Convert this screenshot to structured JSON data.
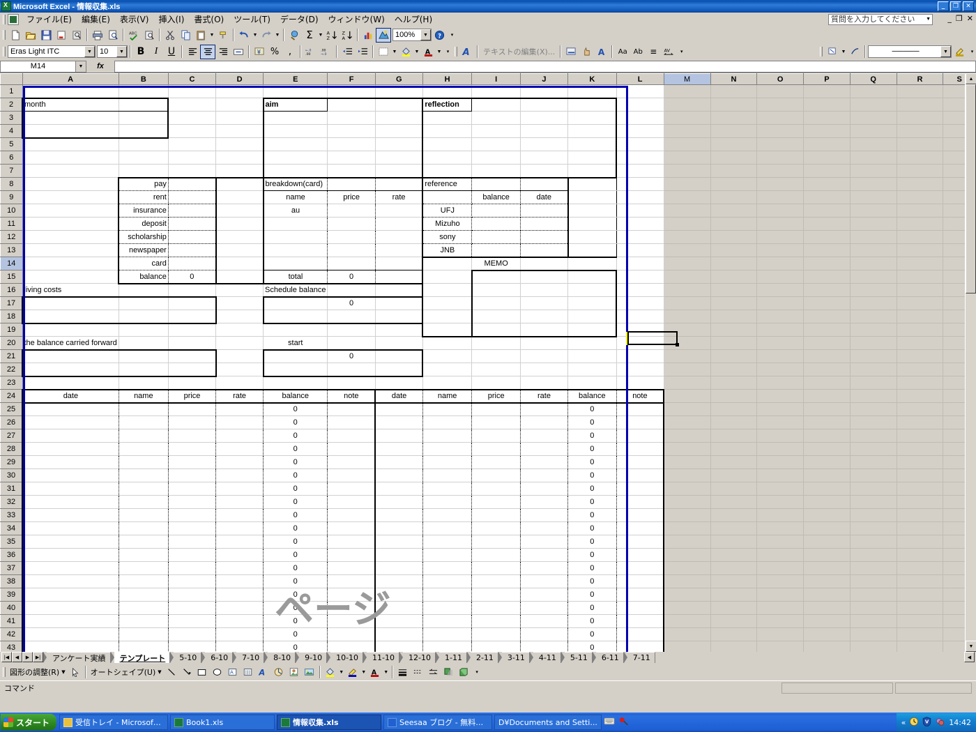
{
  "window": {
    "title": "Microsoft Excel - 情報収集.xls",
    "app_icon": "excel-icon",
    "minimize": "_",
    "maximize": "❐",
    "close": "✕"
  },
  "menubar": {
    "items": [
      {
        "label": "ファイル(E)",
        "name": "menu-file"
      },
      {
        "label": "編集(E)",
        "name": "menu-edit"
      },
      {
        "label": "表示(V)",
        "name": "menu-view"
      },
      {
        "label": "挿入(I)",
        "name": "menu-insert"
      },
      {
        "label": "書式(O)",
        "name": "menu-format"
      },
      {
        "label": "ツール(T)",
        "name": "menu-tools"
      },
      {
        "label": "データ(D)",
        "name": "menu-data"
      },
      {
        "label": "ウィンドウ(W)",
        "name": "menu-window"
      },
      {
        "label": "ヘルプ(H)",
        "name": "menu-help"
      }
    ],
    "ask_box_placeholder": "質問を入力してください",
    "doc_minimize": "_",
    "doc_restore": "❐",
    "doc_close": "✕"
  },
  "standard_toolbar": {
    "zoom_value": "100%",
    "buttons": [
      {
        "name": "new-icon",
        "glyph": "🗋"
      },
      {
        "name": "open-icon",
        "glyph": "🗁"
      },
      {
        "name": "save-icon",
        "glyph": "💾"
      },
      {
        "name": "mail-icon",
        "glyph": "✉"
      },
      {
        "name": "search-icon",
        "glyph": "🔍"
      },
      {
        "name": "print-icon",
        "glyph": "🖨"
      },
      {
        "name": "print-preview-icon",
        "glyph": "🔎"
      },
      {
        "name": "spellcheck-icon",
        "glyph": "ABC"
      },
      {
        "name": "research-icon",
        "glyph": "📑"
      },
      {
        "name": "cut-icon",
        "glyph": "✂"
      },
      {
        "name": "copy-icon",
        "glyph": "⧉"
      },
      {
        "name": "paste-icon",
        "glyph": "📋"
      },
      {
        "name": "format-painter-icon",
        "glyph": "🖌"
      },
      {
        "name": "undo-icon",
        "glyph": "↶"
      },
      {
        "name": "redo-icon",
        "glyph": "↷"
      },
      {
        "name": "hyperlink-icon",
        "glyph": "🌐"
      },
      {
        "name": "autosum-icon",
        "glyph": "Σ"
      },
      {
        "name": "sort-asc-icon",
        "glyph": "A↓"
      },
      {
        "name": "sort-desc-icon",
        "glyph": "Z↓"
      },
      {
        "name": "chart-wizard-icon",
        "glyph": "📊"
      },
      {
        "name": "drawing-icon",
        "glyph": "◮"
      },
      {
        "name": "help-icon",
        "glyph": "?"
      }
    ]
  },
  "formatting_toolbar": {
    "font_name": "Eras Light ITC",
    "font_size": "10",
    "bold": "B",
    "italic": "I",
    "underline": "U",
    "align_left": "≡",
    "align_center": "≡",
    "align_right": "≡",
    "merge_center": "⊞",
    "currency": "¥",
    "percent": "%",
    "comma": ",",
    "inc_decimal": ".00",
    "dec_decimal": ".0",
    "dec_indent": "⇤",
    "inc_indent": "⇥",
    "borders": "⊞",
    "fill_color": "🪣",
    "font_color": "A"
  },
  "wordart_toolbar": {
    "insert_wordart": "A",
    "edit_text_label": "テキストの編集(X)...",
    "gallery": "▤",
    "format": "✋",
    "shape": "A",
    "same_height": "Aa",
    "vertical_text": "Ab",
    "align": "≡",
    "char_spacing": "AV"
  },
  "lines_toolbar": {
    "shadow_style": "▨",
    "line_style": "─────"
  },
  "formula_bar": {
    "name_box_value": "M14",
    "fx_label": "fx",
    "formula_value": ""
  },
  "grid": {
    "columns": [
      "A",
      "B",
      "C",
      "D",
      "E",
      "F",
      "G",
      "H",
      "I",
      "J",
      "K",
      "L",
      "M",
      "N",
      "O",
      "P",
      "Q",
      "R",
      "S"
    ],
    "selected_column": "M",
    "selected_row": 14,
    "selected_cell": "M14",
    "rows_visible": [
      1,
      2,
      3,
      4,
      5,
      6,
      7,
      8,
      9,
      10,
      11,
      12,
      13,
      14,
      15,
      16,
      17,
      18,
      19,
      20,
      21,
      22,
      23,
      24,
      25,
      26,
      27,
      28,
      29,
      30,
      31,
      32,
      33,
      34,
      35,
      36,
      37,
      38,
      39,
      40,
      41,
      42,
      43
    ],
    "watermark": "ページ",
    "cells": {
      "A2": "month",
      "E2": "aim",
      "H2": "reflection",
      "B8": "pay",
      "B9": "rent",
      "B10": "insurance",
      "B11": "deposit",
      "B12": "scholarship",
      "B13": "newspaper",
      "B14": "card",
      "B15": "balance",
      "C15": "0",
      "E8": "breakdown(card)",
      "E9": "name",
      "F9": "price",
      "G9": "rate",
      "E10": "au",
      "E15": "total",
      "F15": "0",
      "H8": "reference",
      "I9": "balance",
      "J9": "date",
      "H10": "UFJ",
      "H11": "Mizuho",
      "H12": "sony",
      "H13": "JNB",
      "I14": "MEMO",
      "A16": "living costs",
      "E16": "Schedule balance",
      "F17": "0",
      "A20": "the balance carried forward",
      "E20": "start",
      "F21": "0"
    },
    "ledger_headers_left": [
      "date",
      "name",
      "price",
      "rate",
      "balance",
      "note"
    ],
    "ledger_headers_right": [
      "date",
      "name",
      "price",
      "rate",
      "balance",
      "note"
    ],
    "ledger_balance_value": "0",
    "ledger_rows_start": 25,
    "ledger_rows_end": 43
  },
  "sheet_tabs": {
    "nav_first": "|◀",
    "nav_prev": "◀",
    "nav_next": "▶",
    "nav_last": "▶|",
    "tabs": [
      {
        "label": "アンケート実績",
        "active": false
      },
      {
        "label": "テンプレート",
        "active": true
      },
      {
        "label": "5-10",
        "active": false
      },
      {
        "label": "6-10",
        "active": false
      },
      {
        "label": "7-10",
        "active": false
      },
      {
        "label": "8-10",
        "active": false
      },
      {
        "label": "9-10",
        "active": false
      },
      {
        "label": "10-10",
        "active": false
      },
      {
        "label": "11-10",
        "active": false
      },
      {
        "label": "12-10",
        "active": false
      },
      {
        "label": "1-11",
        "active": false
      },
      {
        "label": "2-11",
        "active": false
      },
      {
        "label": "3-11",
        "active": false
      },
      {
        "label": "4-11",
        "active": false
      },
      {
        "label": "5-11",
        "active": false
      },
      {
        "label": "6-11",
        "active": false
      },
      {
        "label": "7-11",
        "active": false
      }
    ]
  },
  "drawing_toolbar": {
    "adjust_label": "図形の調整(R)",
    "autoshape_label": "オートシェイプ(U)",
    "select_icon": "↖",
    "line_icon": "＼",
    "arrow_icon": "↘",
    "rect_icon": "▭",
    "oval_icon": "◯",
    "textbox_icon": "▤",
    "vertical_textbox_icon": "▥",
    "wordart_icon": "A",
    "diagram_icon": "◔",
    "clipart_icon": "🖼",
    "picture_icon": "🏞",
    "fill_icon": "🪣",
    "line_color_icon": "🖉",
    "font_color_icon": "A",
    "line_style_icon": "≡",
    "dash_style_icon": "┅",
    "arrow_style_icon": "⇄",
    "shadow_icon": "▮",
    "3d_icon": "▧"
  },
  "status_bar": {
    "mode": "コマンド",
    "right_panels": [
      "",
      ""
    ]
  },
  "taskbar": {
    "start_label": "スタート",
    "items": [
      {
        "label": "受信トレイ - Microsoft O...",
        "icon": "outlook-icon",
        "active": false
      },
      {
        "label": "Book1.xls",
        "icon": "excel-icon",
        "active": false
      },
      {
        "label": "情報収集.xls",
        "icon": "excel-icon",
        "active": true
      },
      {
        "label": "Seesaa ブログ - 無料のブ...",
        "icon": "ie-icon",
        "active": false
      },
      {
        "label": "D¥Documents and Setti...",
        "icon": "folder-icon",
        "active": false
      }
    ],
    "tray": {
      "expand": "«",
      "icons": [
        "clock-icon",
        "antivirus-icon",
        "network-icon"
      ],
      "clock": "14:42"
    }
  },
  "colors": {
    "titlebar_blue": "#0a53b4",
    "face": "#d4d0c8",
    "selection_header": "#b4c4e0",
    "page_break_blue": "#0000b0",
    "outside_print_area": "#d4d0c8",
    "watermark_gray": "#9a9a9a"
  }
}
